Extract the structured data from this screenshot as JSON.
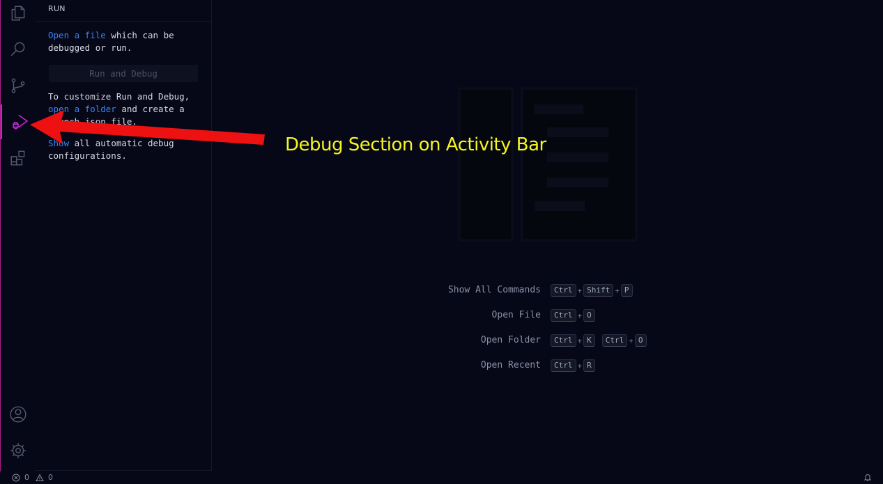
{
  "sidebar": {
    "title": "RUN",
    "open_file_link": "Open a file",
    "open_file_rest": " which can be debugged or run.",
    "run_button": "Run and Debug",
    "customize_text": "To customize Run and Debug, ",
    "open_folder_link": "open a folder",
    "customize_rest": " and create a launch.json file.",
    "show_link": "Show",
    "show_rest": " all automatic debug configurations."
  },
  "activity_bar": {
    "items": [
      "explorer-icon",
      "search-icon",
      "source-control-icon",
      "run-debug-icon",
      "extensions-icon"
    ],
    "bottom_items": [
      "accounts-icon",
      "settings-gear-icon"
    ],
    "accent": "#c026d3"
  },
  "shortcuts": [
    {
      "label": "Show All Commands",
      "keys": [
        "Ctrl",
        "Shift",
        "P"
      ]
    },
    {
      "label": "Open File",
      "keys": [
        "Ctrl",
        "O"
      ]
    },
    {
      "label": "Open Folder",
      "keys": [
        "Ctrl",
        "K"
      ],
      "keys2": [
        "Ctrl",
        "O"
      ]
    },
    {
      "label": "Open Recent",
      "keys": [
        "Ctrl",
        "R"
      ]
    }
  ],
  "annotation": {
    "text": "Debug Section on Activity Bar",
    "color": "#f5f520",
    "arrow_color": "#ee1111"
  },
  "statusbar": {
    "errors": "0",
    "warnings": "0"
  }
}
